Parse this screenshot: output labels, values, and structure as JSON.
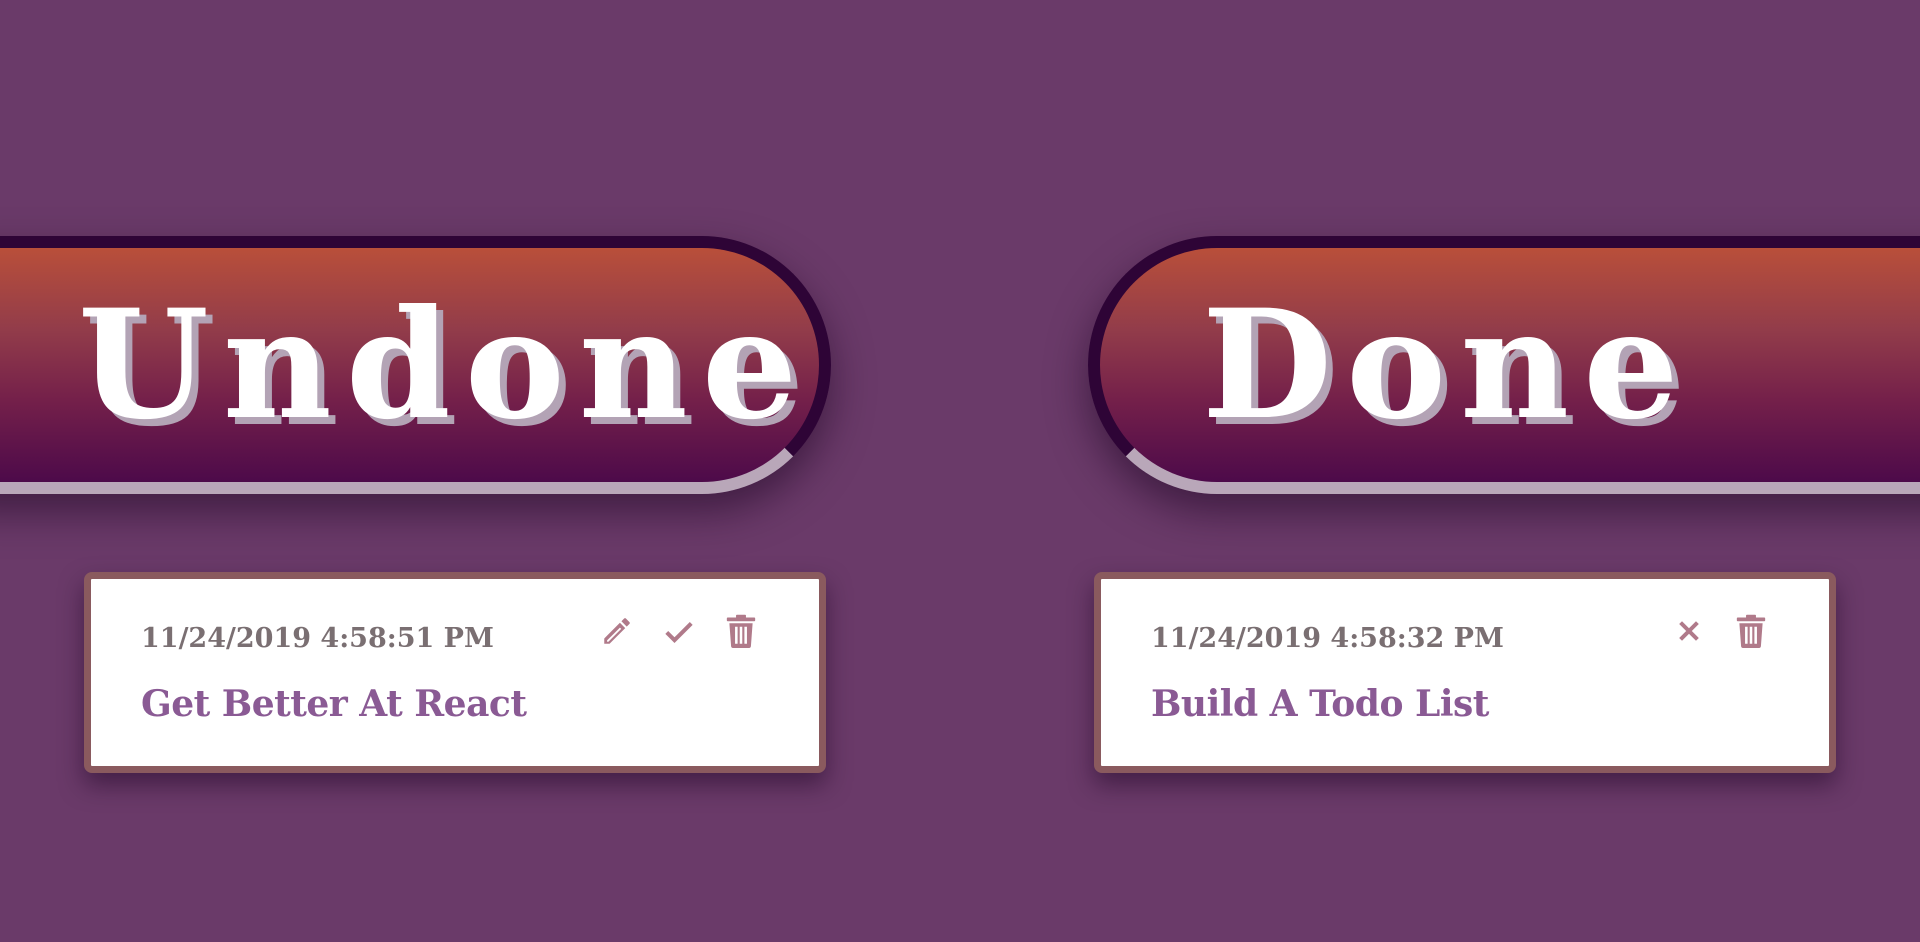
{
  "colors": {
    "background": "#6a3a69",
    "banner_top": "#b94f3a",
    "banner_bottom": "#4d0a4a",
    "card_border": "#8a5a5e",
    "title_text": "#8a5a94",
    "icon": "#b07a8a"
  },
  "columns": {
    "undone": {
      "heading": "Undone",
      "todos": [
        {
          "timestamp": "11/24/2019 4:58:51 PM",
          "title": "Get Better At React",
          "actions": [
            "pencil-icon",
            "check-icon",
            "trash-icon"
          ]
        }
      ]
    },
    "done": {
      "heading": "Done",
      "todos": [
        {
          "timestamp": "11/24/2019 4:58:32 PM",
          "title": "Build A Todo List",
          "actions": [
            "close-icon",
            "trash-icon"
          ]
        }
      ]
    }
  }
}
